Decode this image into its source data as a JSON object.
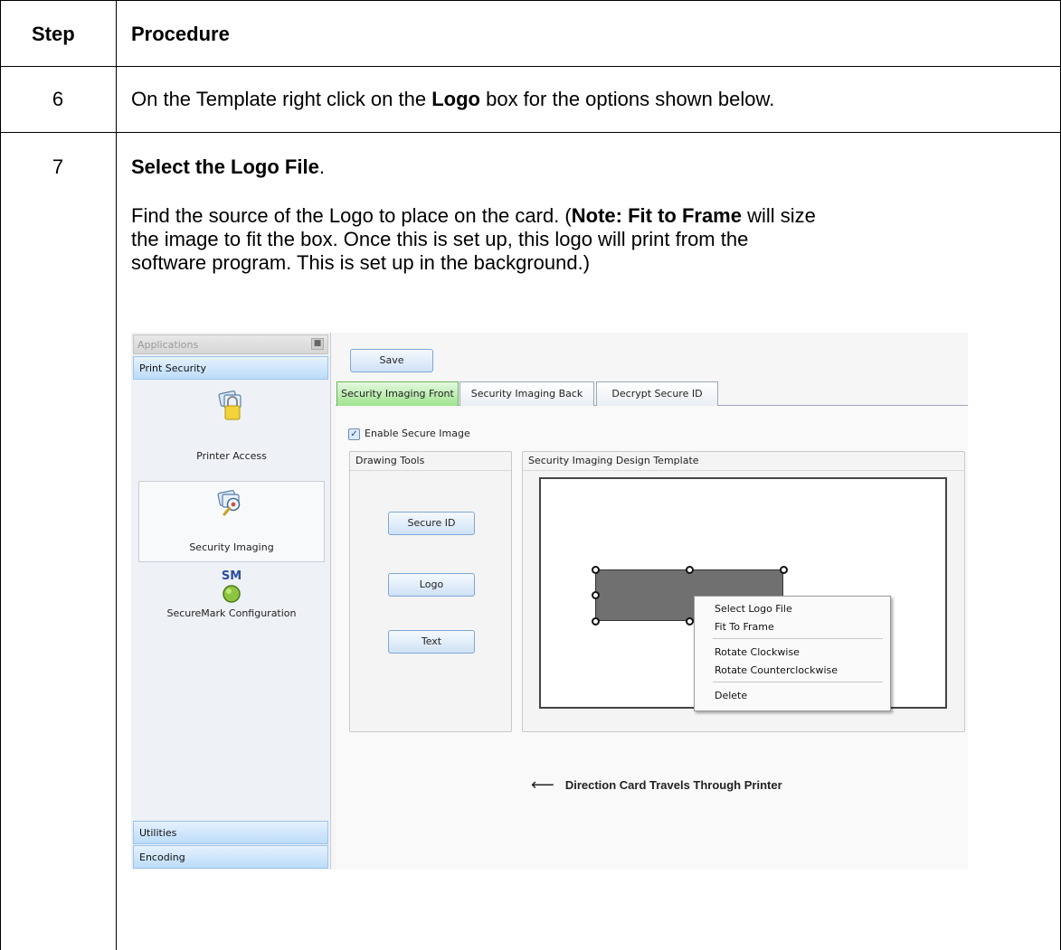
{
  "table": {
    "header_step": "Step",
    "header_procedure": "Procedure",
    "rows": [
      {
        "step": "6",
        "text_before": "On the Template right click on the ",
        "text_bold": "Logo",
        "text_after": " box for the options shown below."
      },
      {
        "step": "7",
        "heading_bold": "Select the Logo File",
        "heading_after": ".",
        "body_before": "Find the source of the Logo to place on the card. (",
        "body_note": "Note:  Fit to Frame",
        "body_after_line1": " will size",
        "body_line2": "the image to fit the box. Once this is set up, this logo will print from the",
        "body_line3": "software program. This is set up in the background.)"
      }
    ]
  },
  "screenshot": {
    "sidebar": {
      "header": "Applications",
      "groups": [
        "Print Security",
        "Utilities",
        "Encoding"
      ],
      "items": [
        {
          "label": "Printer Access",
          "icon": "lock-card-icon"
        },
        {
          "label": "Security Imaging",
          "icon": "magnifier-card-icon"
        },
        {
          "label": "SecureMark Configuration",
          "icon": "securemark-icon",
          "badge": "SM"
        }
      ]
    },
    "toolbar": {
      "save_label": "Save"
    },
    "tabs": [
      "Security Imaging Front",
      "Security Imaging Back",
      "Decrypt Secure ID"
    ],
    "enable_label": "Enable Secure Image",
    "enable_checked": true,
    "drawing_tools": {
      "title": "Drawing Tools",
      "buttons": [
        "Secure ID",
        "Logo",
        "Text"
      ]
    },
    "template": {
      "title": "Security Imaging Design Template"
    },
    "context_menu": {
      "items": [
        "Select Logo File",
        "Fit To Frame",
        "Rotate Clockwise",
        "Rotate Counterclockwise",
        "Delete"
      ]
    },
    "direction_label": "Direction Card Travels Through Printer"
  },
  "colors": {
    "active_tab": "#9ee38c",
    "button_fill": "#cfe2f6",
    "group_fill": "#bcdcfa",
    "logo_box": "#707070"
  }
}
